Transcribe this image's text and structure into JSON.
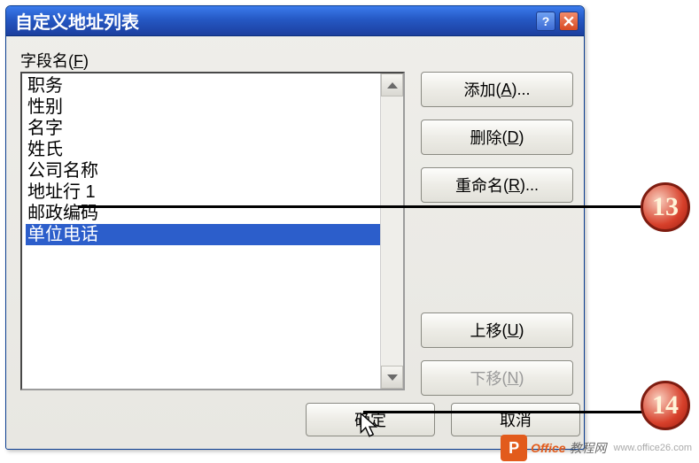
{
  "dialog": {
    "title": "自定义地址列表",
    "help_symbol": "?",
    "field_label_prefix": "字段名",
    "field_label_accel": "F",
    "list": {
      "items": [
        {
          "label": "职务"
        },
        {
          "label": "性别"
        },
        {
          "label": "名字"
        },
        {
          "label": "姓氏"
        },
        {
          "label": "公司名称"
        },
        {
          "label": "地址行 1"
        },
        {
          "label": "邮政编码"
        },
        {
          "label": "单位电话"
        }
      ],
      "selected_index": 7
    },
    "buttons": {
      "add": {
        "label": "添加",
        "accel": "A",
        "suffix": "..."
      },
      "delete": {
        "label": "删除",
        "accel": "D",
        "suffix": ""
      },
      "rename": {
        "label": "重命名",
        "accel": "R",
        "suffix": "..."
      },
      "moveup": {
        "label": "上移",
        "accel": "U",
        "suffix": ""
      },
      "movedown": {
        "label": "下移",
        "accel": "N",
        "suffix": "",
        "disabled": true
      },
      "ok": {
        "label": "确定"
      },
      "cancel": {
        "label": "取消"
      }
    }
  },
  "callouts": {
    "n13": "13",
    "n14": "14"
  },
  "watermark": {
    "logo_letter": "P",
    "text1": "Office",
    "text2": "教程网",
    "url": "www.office26.com"
  }
}
